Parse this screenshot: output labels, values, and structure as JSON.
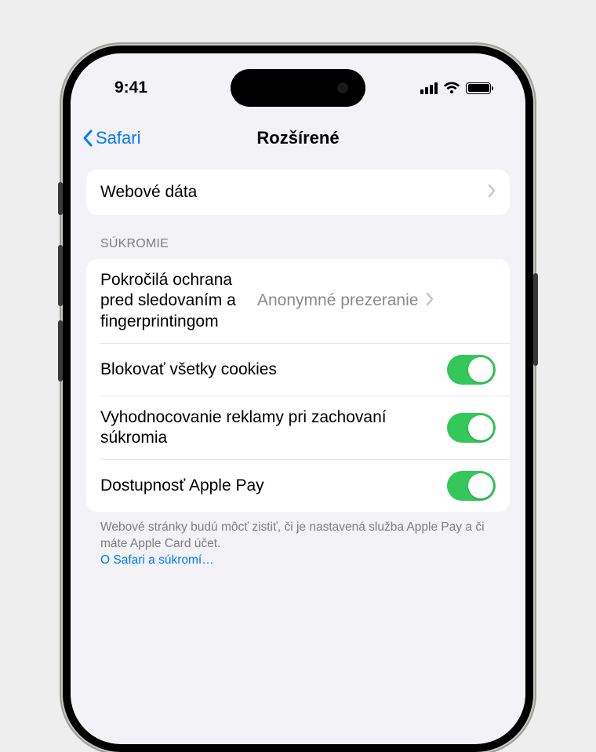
{
  "status": {
    "time": "9:41"
  },
  "nav": {
    "back_label": "Safari",
    "title": "Rozšírené"
  },
  "group_web": {
    "website_data_label": "Webové dáta"
  },
  "privacy": {
    "header": "SÚKROMIE",
    "tracking_label": "Pokročilá ochrana pred sledovaním a fingerprintingom",
    "tracking_value": "Anonymné prezeranie",
    "block_cookies_label": "Blokovať všetky cookies",
    "ad_measurement_label": "Vyhodnocovanie reklamy pri zachovaní súkromia",
    "apple_pay_label": "Dostupnosť Apple Pay",
    "footer_text": "Webové stránky budú môcť zistiť, či je nastavená služba Apple Pay a či máte Apple Card účet.",
    "footer_link": "O Safari a súkromí…"
  }
}
